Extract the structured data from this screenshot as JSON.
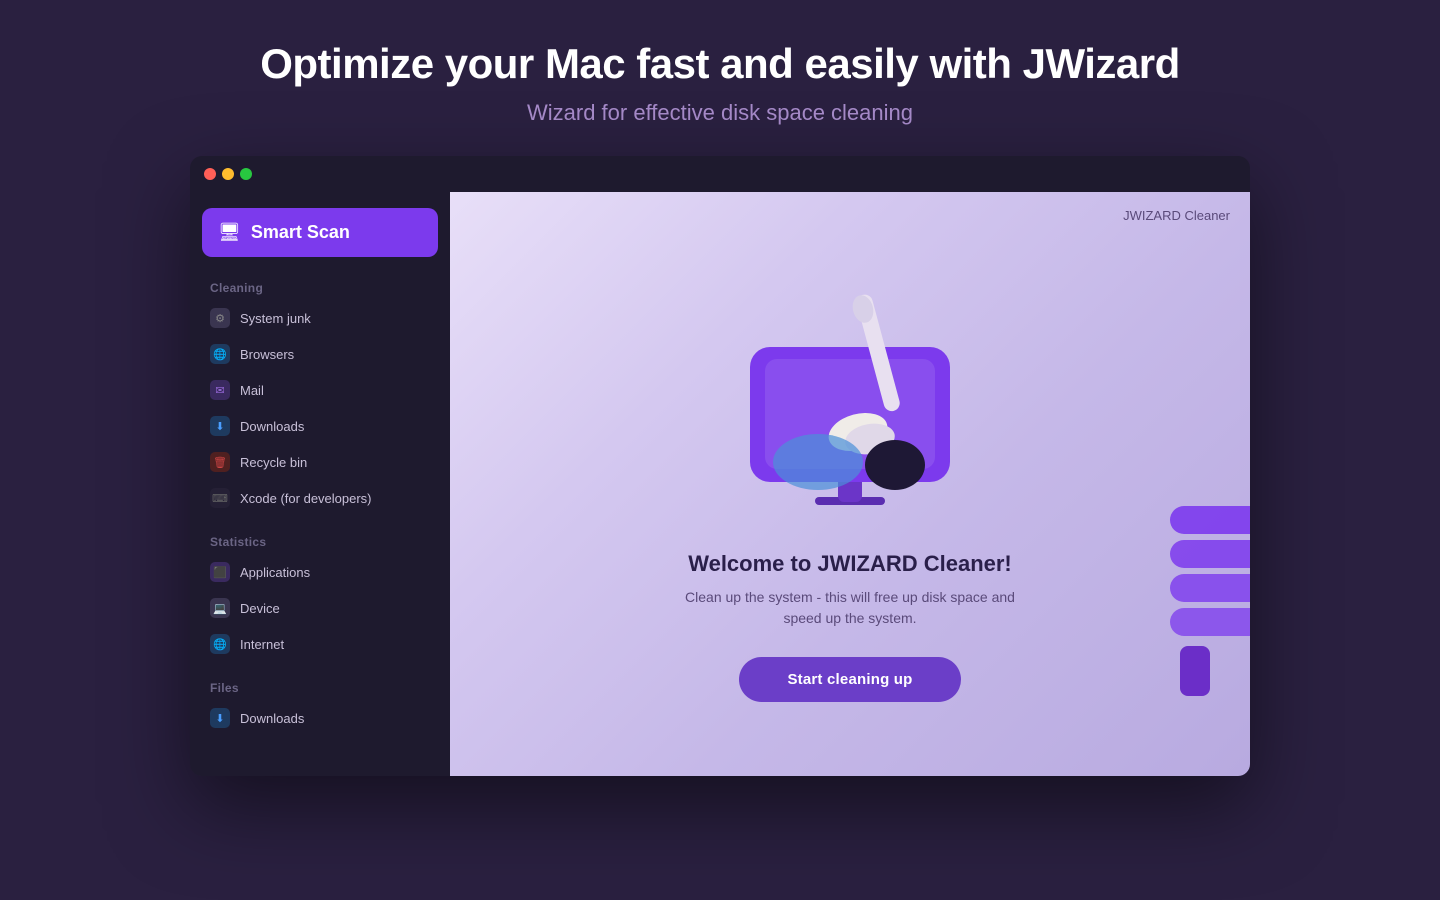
{
  "page": {
    "title": "Optimize your Mac fast and easily with JWizard",
    "subtitle": "Wizard for effective disk space cleaning"
  },
  "titlebar": {
    "lights": [
      "red",
      "yellow",
      "green"
    ]
  },
  "sidebar": {
    "smart_scan_label": "Smart Scan",
    "sections": [
      {
        "title": "Cleaning",
        "items": [
          {
            "label": "System junk",
            "icon": "gear"
          },
          {
            "label": "Browsers",
            "icon": "browser"
          },
          {
            "label": "Mail",
            "icon": "mail"
          },
          {
            "label": "Downloads",
            "icon": "download"
          },
          {
            "label": "Recycle bin",
            "icon": "trash"
          },
          {
            "label": "Xcode (for developers)",
            "icon": "code"
          }
        ]
      },
      {
        "title": "Statistics",
        "items": [
          {
            "label": "Applications",
            "icon": "apps"
          },
          {
            "label": "Device",
            "icon": "device"
          },
          {
            "label": "Internet",
            "icon": "globe"
          }
        ]
      },
      {
        "title": "Files",
        "items": [
          {
            "label": "Downloads",
            "icon": "download"
          }
        ]
      }
    ]
  },
  "main": {
    "app_label": "JWIZARD Cleaner",
    "welcome_title": "Welcome to JWIZARD Cleaner!",
    "welcome_desc": "Clean up the system - this will free up disk space and speed up the system.",
    "start_button": "Start cleaning up"
  }
}
